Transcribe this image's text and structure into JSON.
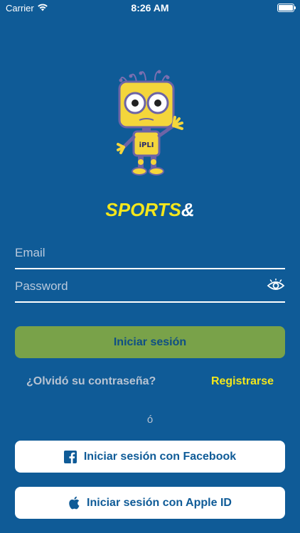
{
  "status": {
    "carrier": "Carrier",
    "time": "8:26 AM"
  },
  "brand": {
    "sports": "SPORTS",
    "amp": "&"
  },
  "mascot": {
    "badge_text": "iPLI"
  },
  "form": {
    "email_placeholder": "Email",
    "password_placeholder": "Password",
    "login_label": "Iniciar sesión",
    "forgot_label": "¿Olvidó su contraseña?",
    "register_label": "Registrarse",
    "or_label": "ó"
  },
  "social": {
    "facebook_label": "Iniciar sesión con Facebook",
    "apple_label": "Iniciar sesión con Apple ID"
  },
  "colors": {
    "background": "#0f5b97",
    "accent_yellow": "#f3e61c",
    "login_green": "#79a249",
    "white": "#ffffff"
  },
  "icons": [
    "wifi-icon",
    "battery-icon",
    "eye-icon",
    "facebook-icon",
    "apple-icon"
  ]
}
